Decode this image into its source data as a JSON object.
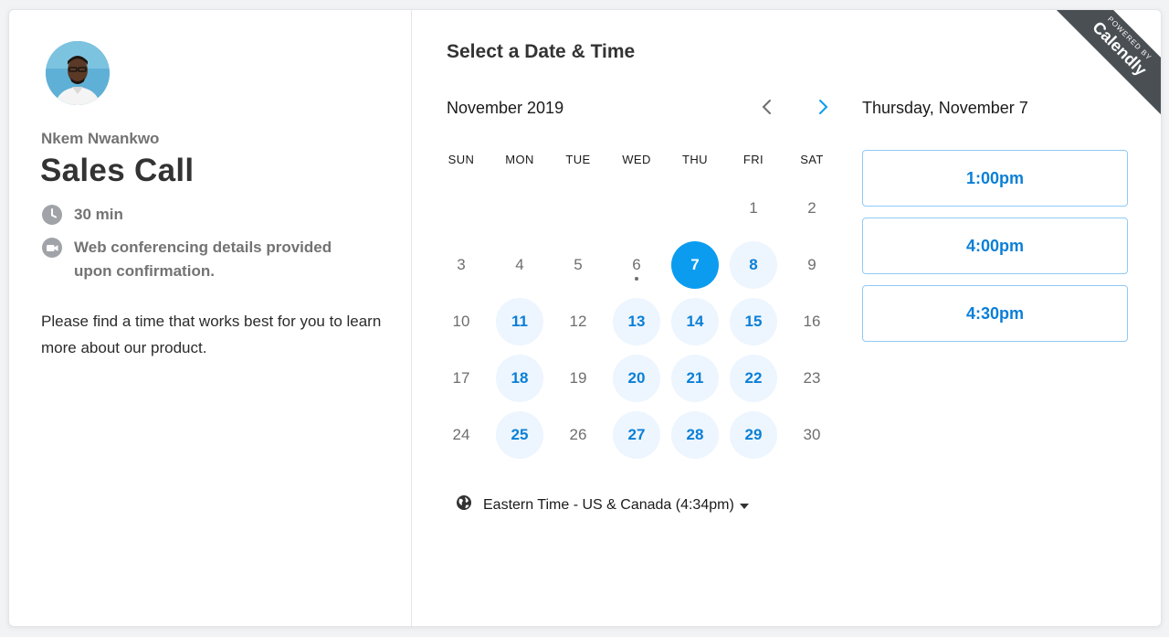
{
  "host": {
    "name": "Nkem Nwankwo"
  },
  "event": {
    "title": "Sales Call",
    "duration": "30 min",
    "conferencing": "Web conferencing details provided upon confirmation.",
    "description": "Please find a time that works best for you to learn more about our product."
  },
  "scheduler": {
    "section_title": "Select a Date & Time",
    "month_label": "November 2019",
    "weekdays": [
      "SUN",
      "MON",
      "TUE",
      "WED",
      "THU",
      "FRI",
      "SAT"
    ],
    "first_weekday_index": 5,
    "days_in_month": 30,
    "available_days": [
      8,
      11,
      13,
      14,
      15,
      18,
      20,
      21,
      22,
      25,
      27,
      28,
      29
    ],
    "selected_day": 7,
    "today_day": 6,
    "timezone": "Eastern Time - US & Canada (4:34pm)",
    "selected_date_label": "Thursday, November 7",
    "time_slots": [
      "1:00pm",
      "4:00pm",
      "4:30pm"
    ]
  },
  "branding": {
    "powered_by": "POWERED BY",
    "name": "Calendly"
  },
  "colors": {
    "accent": "#0b9cf0",
    "link": "#0a7fd6",
    "available_bg": "#edf5fe",
    "ribbon": "#4a4f54"
  },
  "icons": {
    "duration": "clock-icon",
    "conferencing": "video-camera-icon",
    "timezone": "globe-icon",
    "prev": "chevron-left-icon",
    "next": "chevron-right-icon",
    "dropdown": "caret-down-icon"
  }
}
